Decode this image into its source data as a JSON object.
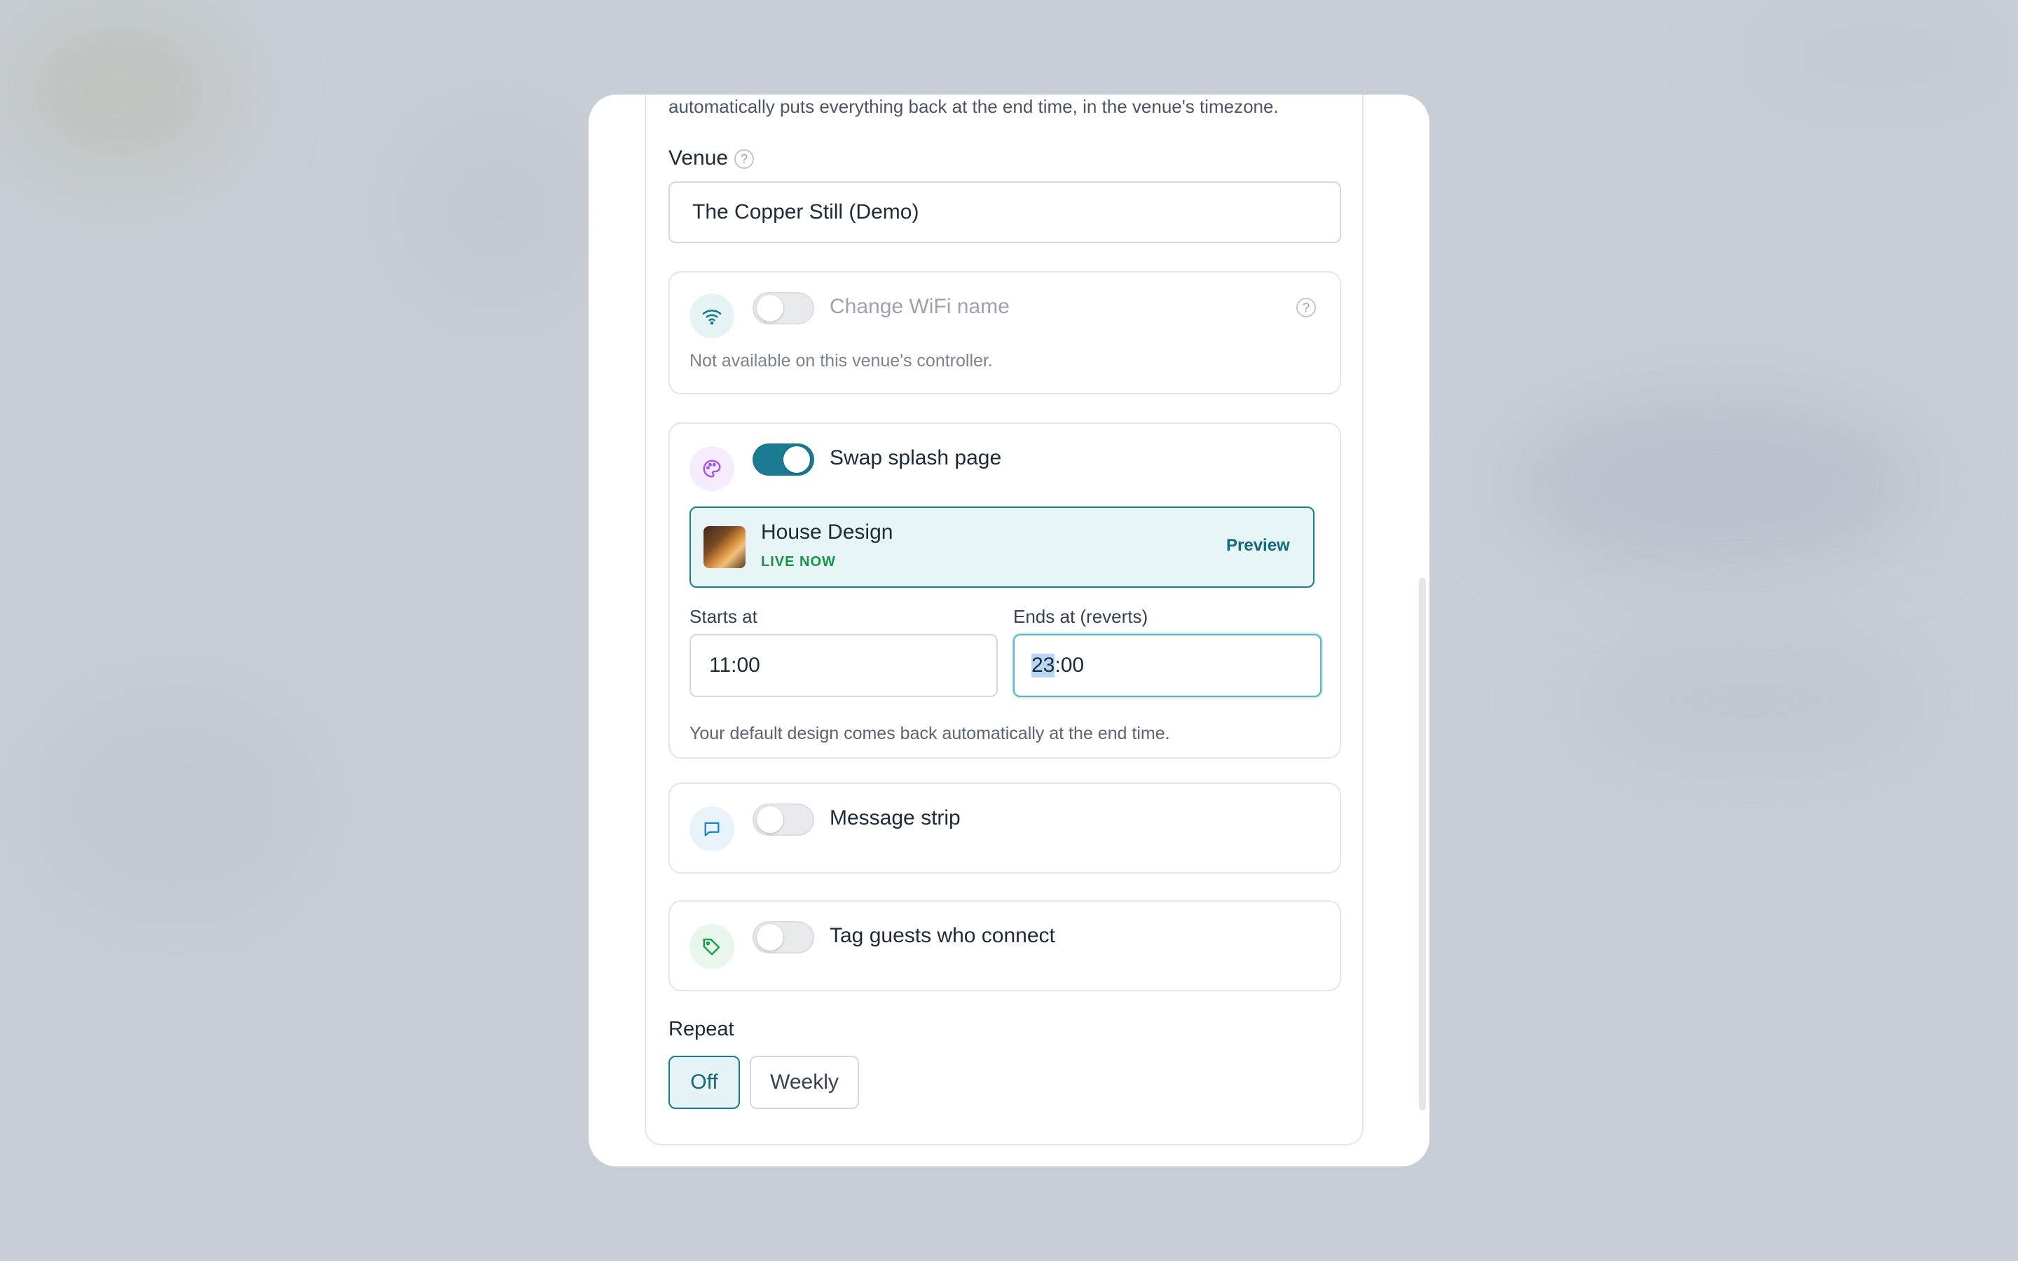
{
  "intro_text": "automatically puts everything back at the end time, in the venue's timezone.",
  "venue": {
    "label": "Venue",
    "help": "?",
    "value": "The Copper Still (Demo)"
  },
  "wifi": {
    "title": "Change WiFi name",
    "note": "Not available on this venue's controller.",
    "enabled": false,
    "help": "?"
  },
  "splash": {
    "title": "Swap splash page",
    "enabled": true,
    "design_name": "House Design",
    "design_status": "LIVE NOW",
    "preview_label": "Preview",
    "starts_label": "Starts at",
    "starts_value": "11:00",
    "ends_label": "Ends at (reverts)",
    "ends_value_hours": "23",
    "ends_value_rest": ":00",
    "note": "Your default design comes back automatically at the end time."
  },
  "message_strip": {
    "title": "Message strip",
    "enabled": false
  },
  "tag_guests": {
    "title": "Tag guests who connect",
    "enabled": false
  },
  "repeat": {
    "label": "Repeat",
    "options": [
      "Off",
      "Weekly"
    ],
    "selected": "Off"
  },
  "colors": {
    "accent": "#1a7a90",
    "live": "#15934a",
    "wifi_icon": "#1a7a90",
    "splash_icon": "#a855f7",
    "message_icon": "#1e88c8",
    "tag_icon": "#16a34a"
  },
  "icons": {
    "wifi": "wifi-icon",
    "splash": "palette-icon",
    "message": "chat-bubble-icon",
    "tag": "tag-icon"
  }
}
